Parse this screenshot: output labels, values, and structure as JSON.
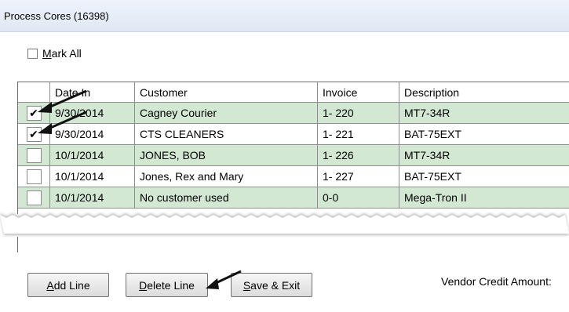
{
  "window": {
    "title": "Process Cores (16398)"
  },
  "mark_all": {
    "label": "Mark All",
    "checked": false
  },
  "grid": {
    "columns": [
      "Date In",
      "Customer",
      "Invoice",
      "Description"
    ],
    "rows": [
      {
        "checked": true,
        "date": "9/30/2014",
        "customer": "Cagney Courier",
        "invoice": "1- 220",
        "description": "MT7-34R"
      },
      {
        "checked": true,
        "date": "9/30/2014",
        "customer": "CTS CLEANERS",
        "invoice": "1- 221",
        "description": "BAT-75EXT"
      },
      {
        "checked": false,
        "date": "10/1/2014",
        "customer": "JONES, BOB",
        "invoice": "1- 226",
        "description": "MT7-34R"
      },
      {
        "checked": false,
        "date": "10/1/2014",
        "customer": "Jones, Rex and Mary",
        "invoice": "1- 227",
        "description": "BAT-75EXT"
      },
      {
        "checked": false,
        "date": "10/1/2014",
        "customer": "No customer used",
        "invoice": "0-0",
        "description": "Mega-Tron II"
      }
    ]
  },
  "buttons": {
    "add_line": "Add Line",
    "delete_line": "Delete Line",
    "save_exit": "Save & Exit"
  },
  "vendor_credit_label": "Vendor Credit Amount:",
  "colors": {
    "row_green": "#d3e8d3",
    "title_bar": "#dfe8f4"
  }
}
